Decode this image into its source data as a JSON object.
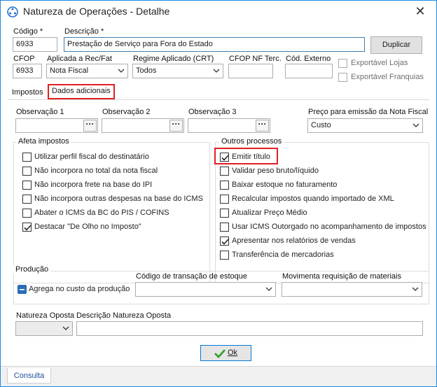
{
  "window": {
    "title": "Natureza de Operações - Detalhe",
    "close_glyph": "✕"
  },
  "header": {
    "codigo_label": "Código *",
    "codigo_value": "6933",
    "descricao_label": "Descrição *",
    "descricao_value": "Prestação de Serviço para Fora do Estado",
    "duplicar_label": "Duplicar",
    "cfop_label": "CFOP",
    "cfop_value": "6933",
    "aplicada_label": "Aplicada a Rec/Fat",
    "aplicada_value": "Nota Fiscal",
    "regime_label": "Regime Aplicado (CRT)",
    "regime_value": "Todos",
    "cfop_nf_label": "CFOP NF Terc.",
    "cfop_nf_value": "",
    "cod_externo_label": "Cód. Externo",
    "cod_externo_value": "",
    "exportavel_lojas_label": "Exportável Lojas",
    "exportavel_franquias_label": "Exportável Franquias"
  },
  "tabs": [
    {
      "label": "Impostos"
    },
    {
      "label": "Dados adicionais"
    }
  ],
  "additional": {
    "obs1_label": "Observação 1",
    "obs2_label": "Observação 2",
    "obs3_label": "Observação 3",
    "ellipsis": "···",
    "preco_label": "Preço para emissão da Nota Fiscal",
    "preco_value": "Custo"
  },
  "afeta": {
    "title": "Afeta impostos",
    "items": [
      {
        "label": "Utilizar perfil fiscal do destinatário",
        "checked": false
      },
      {
        "label": "Não incorpora no total da nota fiscal",
        "checked": false
      },
      {
        "label": "Não incorpora frete na base do IPI",
        "checked": false
      },
      {
        "label": "Não incorpora outras despesas na base do ICMS",
        "checked": false
      },
      {
        "label": "Abater o ICMS da BC do PIS / COFINS",
        "checked": false
      },
      {
        "label": "Destacar \"De Olho no Imposto\"",
        "checked": true
      }
    ]
  },
  "outros": {
    "title": "Outros processos",
    "items": [
      {
        "label": "Emitir título",
        "checked": true
      },
      {
        "label": "Validar peso bruto/líquido",
        "checked": false
      },
      {
        "label": "Baixar estoque no faturamento",
        "checked": false
      },
      {
        "label": "Recalcular impostos quando importado de XML",
        "checked": false
      },
      {
        "label": "Atualizar Preço Médio",
        "checked": false
      },
      {
        "label": "Usar ICMS Outorgado no acompanhamento de impostos",
        "checked": false
      },
      {
        "label": "Apresentar nos relatórios de vendas",
        "checked": true
      },
      {
        "label": "Transferência de mercadorias",
        "checked": false
      }
    ]
  },
  "producao": {
    "title": "Produção",
    "agrega_label": "Agrega no custo da produção",
    "codigo_transacao_label": "Código de transação de estoque",
    "codigo_transacao_value": "",
    "movimenta_label": "Movimenta requisição de materiais",
    "movimenta_value": ""
  },
  "oposta": {
    "natureza_label": "Natureza Oposta",
    "natureza_value": "",
    "descricao_label": "Descrição Natureza Oposta",
    "descricao_value": ""
  },
  "footer": {
    "ok_label": "Ok",
    "status_tab_label": "Consulta"
  },
  "colors": {
    "highlight": "#e02020",
    "accent": "#2b6cb8",
    "ok_check": "#2e9e2e"
  }
}
